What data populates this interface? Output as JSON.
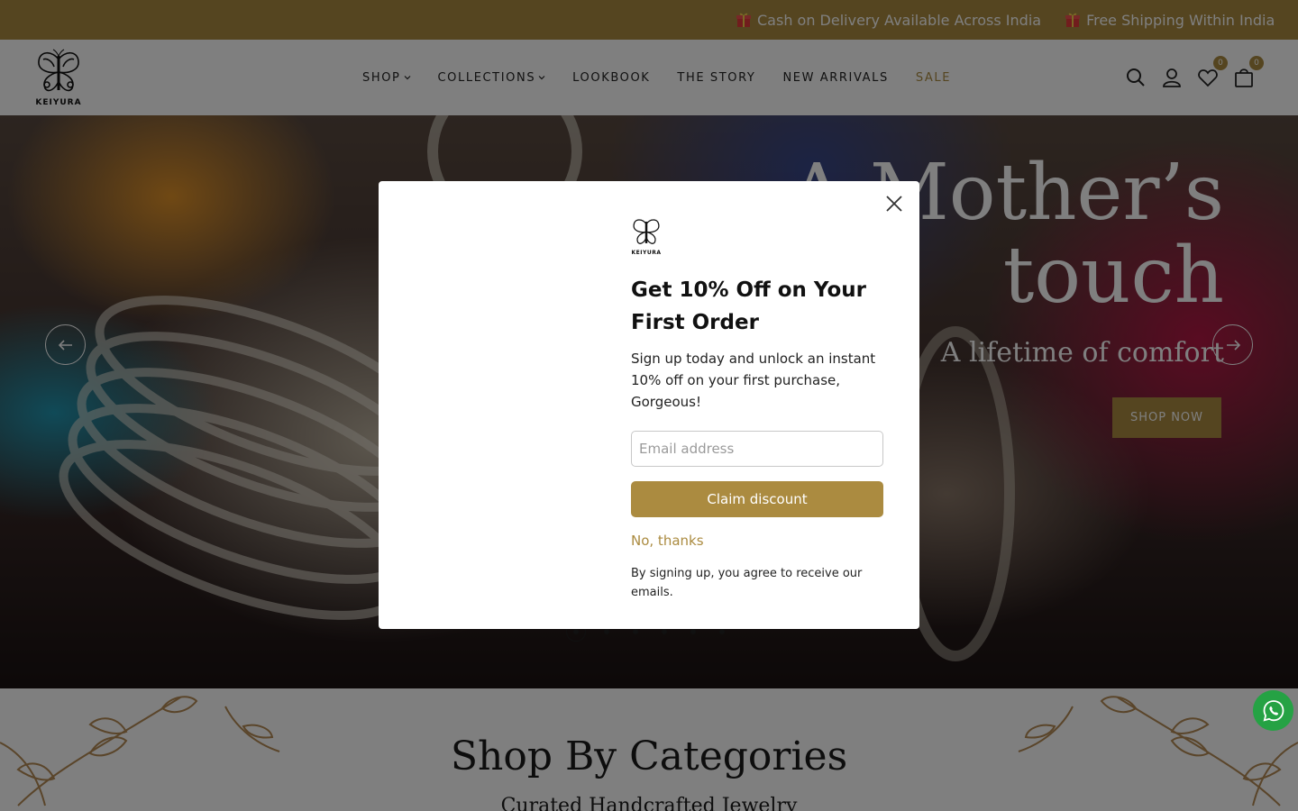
{
  "announcement": {
    "items": [
      {
        "icon": "gift-icon",
        "text": "Cash on Delivery Available Across India"
      },
      {
        "icon": "gift-icon",
        "text": "Free Shipping Within India"
      }
    ]
  },
  "header": {
    "logo_text": "KEIYURA",
    "nav": [
      {
        "label": "SHOP",
        "has_dropdown": true
      },
      {
        "label": "COLLECTIONS",
        "has_dropdown": true
      },
      {
        "label": "LOOKBOOK",
        "has_dropdown": false
      },
      {
        "label": "THE STORY",
        "has_dropdown": false
      },
      {
        "label": "NEW ARRIVALS",
        "has_dropdown": false
      },
      {
        "label": "SALE",
        "has_dropdown": false
      }
    ],
    "wishlist_count": "0",
    "cart_count": "0"
  },
  "hero": {
    "title_line1": "A Mother’s",
    "title_line2": "touch",
    "subtitle": "A lifetime of comfort",
    "cta": "SHOP NOW",
    "slide_count": 6,
    "active_slide": 1
  },
  "categories": {
    "title": "Shop By Categories",
    "subtitle": "Curated Handcrafted Jewelry"
  },
  "popup": {
    "logo_text": "KEIYURA",
    "title": "Get 10% Off on Your First Order",
    "body": "Sign up today and unlock an instant 10% off on your first purchase, Gorgeous!",
    "email_placeholder": "Email address",
    "email_value": "",
    "submit_label": "Claim discount",
    "dismiss_label": "No, thanks",
    "legal": "By signing up, you agree to receive our emails."
  },
  "colors": {
    "accent": "#ab8b40",
    "whatsapp": "#25a244"
  }
}
